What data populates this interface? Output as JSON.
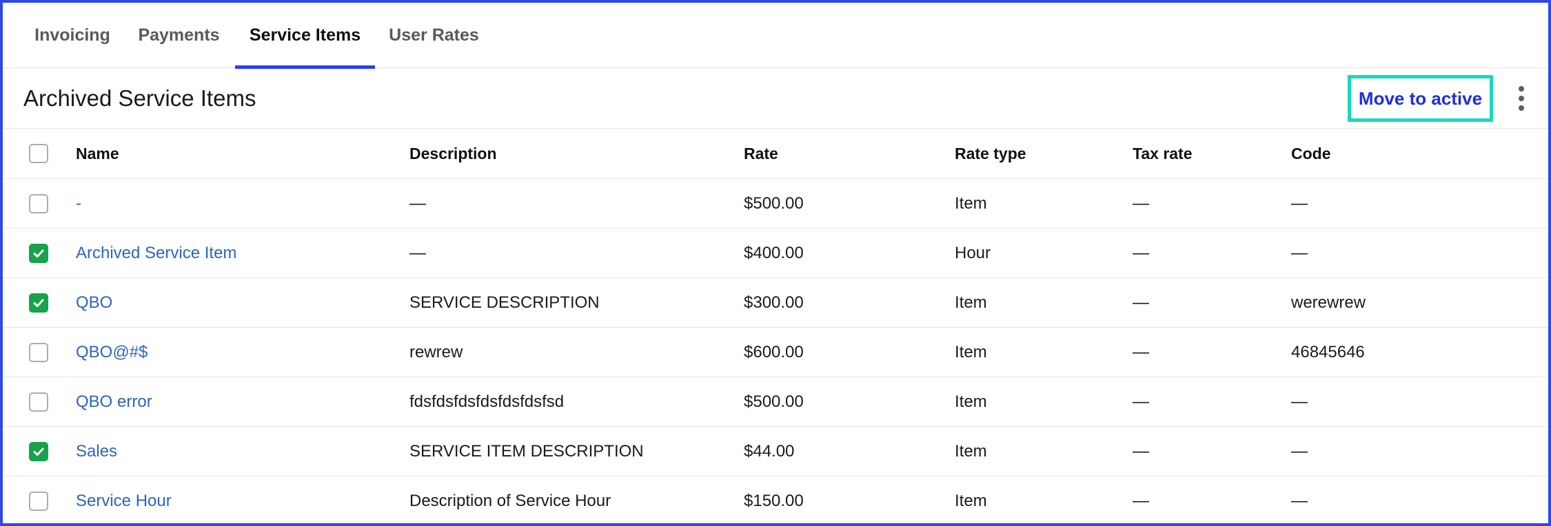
{
  "tabs": [
    {
      "label": "Invoicing",
      "active": false
    },
    {
      "label": "Payments",
      "active": false
    },
    {
      "label": "Service Items",
      "active": true
    },
    {
      "label": "User Rates",
      "active": false
    }
  ],
  "header": {
    "title": "Archived Service Items",
    "move_button": "Move to active",
    "more_icon": "kebab-menu-icon"
  },
  "table": {
    "columns": [
      "Name",
      "Description",
      "Rate",
      "Rate type",
      "Tax rate",
      "Code"
    ],
    "header_checked": false,
    "rows": [
      {
        "checked": false,
        "name": "-",
        "description": "—",
        "rate": "$500.00",
        "rate_type": "Item",
        "tax_rate": "—",
        "code": "—"
      },
      {
        "checked": true,
        "name": "Archived Service Item",
        "description": "—",
        "rate": "$400.00",
        "rate_type": "Hour",
        "tax_rate": "—",
        "code": "—"
      },
      {
        "checked": true,
        "name": "QBO",
        "description": "SERVICE DESCRIPTION",
        "rate": "$300.00",
        "rate_type": "Item",
        "tax_rate": "—",
        "code": "werewrew"
      },
      {
        "checked": false,
        "name": "QBO@#$",
        "description": "rewrew",
        "rate": "$600.00",
        "rate_type": "Item",
        "tax_rate": "—",
        "code": "46845646"
      },
      {
        "checked": false,
        "name": "QBO error",
        "description": "fdsfdsfdsfdsfdsfdsfsd",
        "rate": "$500.00",
        "rate_type": "Item",
        "tax_rate": "—",
        "code": "—"
      },
      {
        "checked": true,
        "name": "Sales",
        "description": "SERVICE ITEM DESCRIPTION",
        "rate": "$44.00",
        "rate_type": "Item",
        "tax_rate": "—",
        "code": "—"
      },
      {
        "checked": false,
        "name": "Service Hour",
        "description": "Description of Service Hour",
        "rate": "$150.00",
        "rate_type": "Item",
        "tax_rate": "—",
        "code": "—"
      }
    ]
  },
  "colors": {
    "frame_border": "#2e48e6",
    "tab_indicator": "#2f3df0",
    "button_text": "#1e2ee0",
    "button_highlight": "#19d8b9",
    "link": "#2d63c6",
    "checkbox_checked": "#16a34a"
  }
}
